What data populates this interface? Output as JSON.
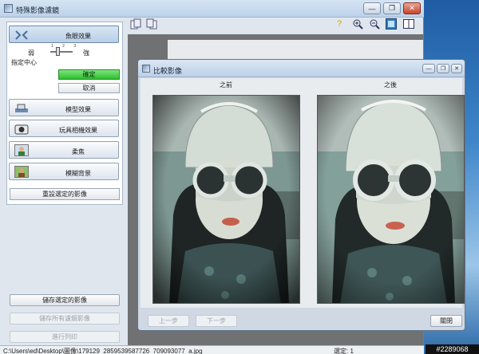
{
  "main_window": {
    "title": "特殊影像濾鏡",
    "controls": {
      "minimize": "—",
      "restore": "❐",
      "close": "✕"
    }
  },
  "left_panel": {
    "active_tool": "魚眼效果",
    "strength": {
      "label": "指定中心",
      "low": "弱",
      "high": "強",
      "ticks": "1 2 3",
      "level": "2 of 3"
    },
    "confirm": "確定",
    "cancel": "取消",
    "tools": [
      {
        "label": "模型效果",
        "icon": "miniature-icon"
      },
      {
        "label": "玩具相機效果",
        "icon": "toy-camera-icon"
      },
      {
        "label": "柔焦",
        "icon": "soft-focus-icon"
      },
      {
        "label": "模糊背景",
        "icon": "blur-background-icon"
      }
    ],
    "reset": "重設選定的影像"
  },
  "bottom_buttons": {
    "save_selected": "儲存選定的影像",
    "save_all": "儲存所有濾鏡影像",
    "print": "進行列印"
  },
  "toolbar_icons": [
    "help-icon",
    "zoom-in-icon",
    "zoom-out-icon",
    "fit-view-icon",
    "compare-view-icon"
  ],
  "compare_dialog": {
    "title": "比較影像",
    "before_label": "之前",
    "after_label": "之後",
    "prev": "上一步",
    "next": "下一步",
    "close": "關閉",
    "controls": {
      "minimize": "—",
      "restore": "❐",
      "close": "✕"
    }
  },
  "status": {
    "path": "C:\\Users\\ed\\Desktop\\圖像\\179129_2859539587726_709093077_a.jpg",
    "selected": "選定: 1"
  },
  "watermark": "#2289068",
  "colors": {
    "confirm_green": "#2dbf2d",
    "title_blue": "#bcd2ea",
    "view_gray": "#6f7173"
  }
}
